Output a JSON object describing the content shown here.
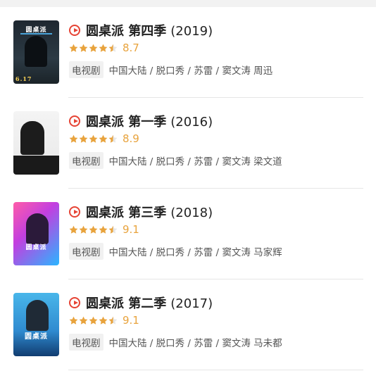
{
  "shows": [
    {
      "title": "圆桌派 第四季",
      "year": "(2019)",
      "rating": 8.7,
      "stars": 4.5,
      "score_text": "8.7",
      "category": "电视剧",
      "details": "中国大陆 / 脱口秀 / 苏雷 / 窦文涛 周迅",
      "poster_label": "圆桌派",
      "poster_tag": "",
      "poster_date": "6.17"
    },
    {
      "title": "圆桌派 第一季",
      "year": "(2016)",
      "rating": 8.9,
      "stars": 4.5,
      "score_text": "8.9",
      "category": "电视剧",
      "details": "中国大陆 / 脱口秀 / 苏雷 / 窦文涛 梁文道",
      "poster_label": "",
      "poster_tag": "",
      "poster_date": ""
    },
    {
      "title": "圆桌派 第三季",
      "year": "(2018)",
      "rating": 9.1,
      "stars": 4.5,
      "score_text": "9.1",
      "category": "电视剧",
      "details": "中国大陆 / 脱口秀 / 苏雷 / 窦文涛 马家辉",
      "poster_label": "圆桌派",
      "poster_tag": "",
      "poster_date": ""
    },
    {
      "title": "圆桌派 第二季",
      "year": "(2017)",
      "rating": 9.1,
      "stars": 4.5,
      "score_text": "9.1",
      "category": "电视剧",
      "details": "中国大陆 / 脱口秀 / 苏雷 / 窦文涛 马未都",
      "poster_label": "圆桌派",
      "poster_tag": "",
      "poster_date": ""
    }
  ],
  "colors": {
    "accent": "#e64334",
    "star": "#e8a33d",
    "divider": "#e6e6e6",
    "text": "#222222",
    "muted": "#555555"
  }
}
